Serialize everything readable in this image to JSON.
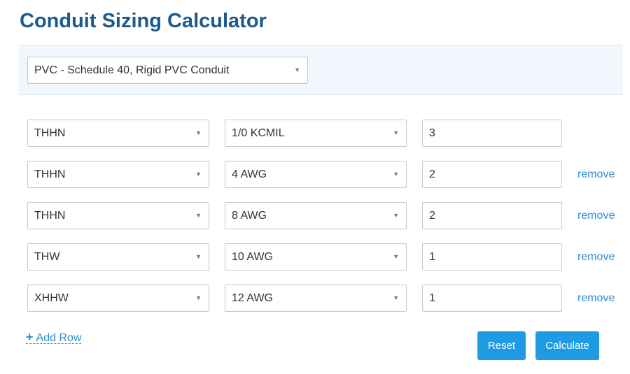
{
  "page": {
    "title": "Conduit Sizing Calculator"
  },
  "conduit": {
    "selected": "PVC - Schedule 40, Rigid PVC Conduit"
  },
  "rows": [
    {
      "insulation": "THHN",
      "size": "1/0 KCMIL",
      "quantity": "3"
    },
    {
      "insulation": "THHN",
      "size": "4 AWG",
      "quantity": "2",
      "remove_label": "remove"
    },
    {
      "insulation": "THHN",
      "size": "8 AWG",
      "quantity": "2",
      "remove_label": "remove"
    },
    {
      "insulation": "THW",
      "size": "10 AWG",
      "quantity": "1",
      "remove_label": "remove"
    },
    {
      "insulation": "XHHW",
      "size": "12 AWG",
      "quantity": "1",
      "remove_label": "remove"
    }
  ],
  "actions": {
    "add_row_label": "Add Row",
    "reset_label": "Reset",
    "calculate_label": "Calculate"
  },
  "colors": {
    "title": "#1d5b8a",
    "accent": "#1e9be3",
    "link": "#2a8fd6",
    "panel_bg": "#f1f7fc"
  },
  "icons": {
    "dropdown": "caret-down-icon",
    "add": "plus-icon"
  }
}
